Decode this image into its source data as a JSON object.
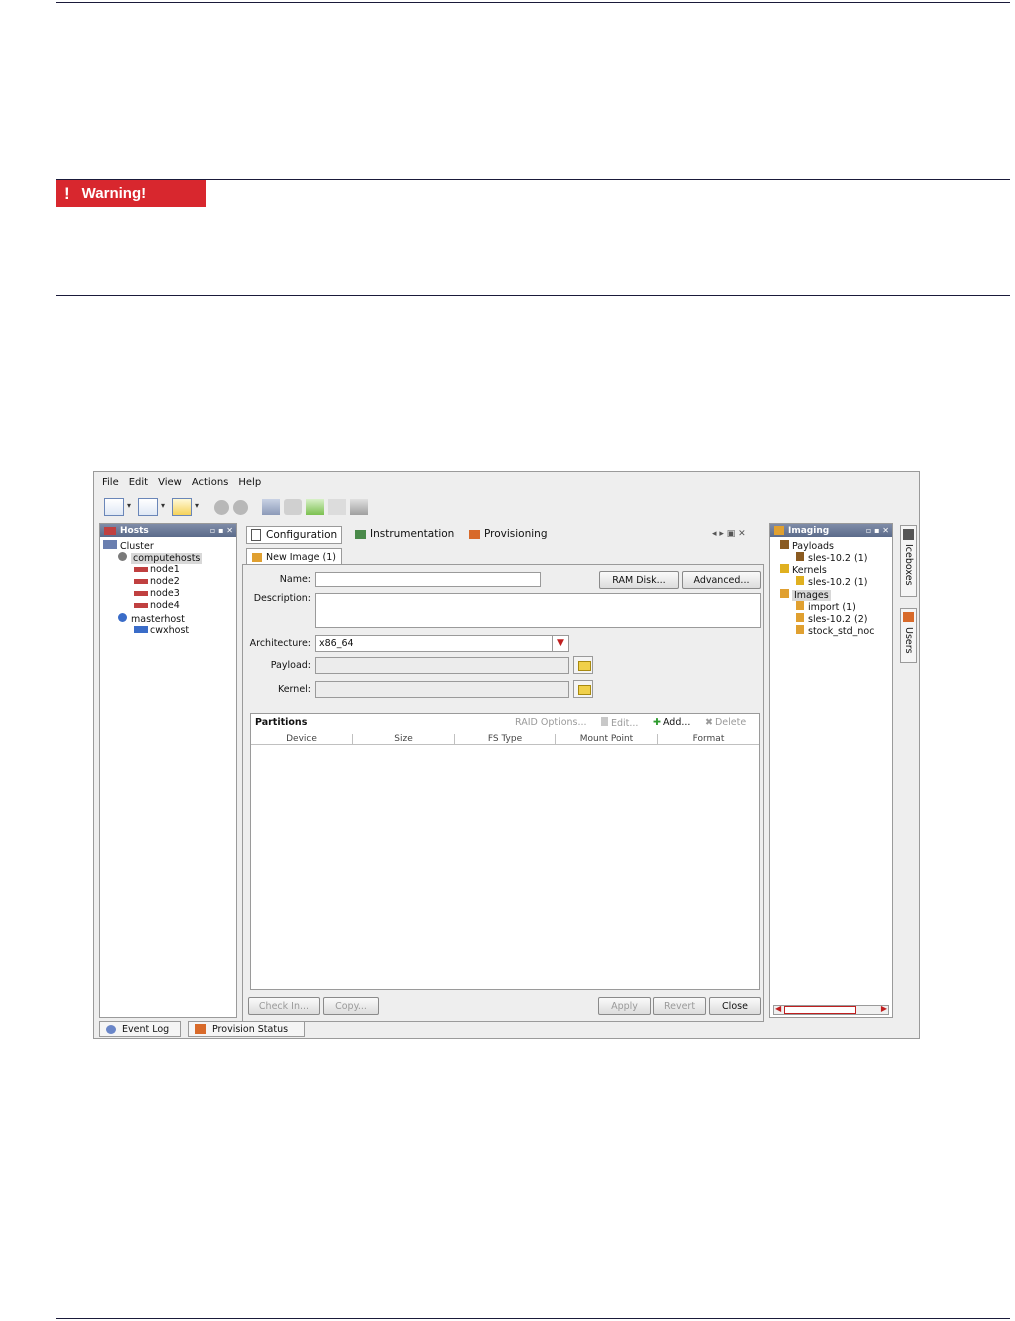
{
  "warning": {
    "label": "Warning!"
  },
  "app": {
    "menu": [
      "File",
      "Edit",
      "View",
      "Actions",
      "Help"
    ],
    "hosts_panel": {
      "title": "Hosts",
      "tree": {
        "root": "Cluster",
        "group1": "computehosts",
        "nodes": [
          "node1",
          "node2",
          "node3",
          "node4"
        ],
        "group2": "masterhost",
        "master_child": "cwxhost"
      }
    },
    "tabs": [
      "Configuration",
      "Instrumentation",
      "Provisioning"
    ],
    "subtab": "New Image (1)",
    "form": {
      "name_label": "Name:",
      "name_value": "",
      "description_label": "Description:",
      "architecture_label": "Architecture:",
      "architecture_value": "x86_64",
      "payload_label": "Payload:",
      "kernel_label": "Kernel:",
      "ram_disk_button": "RAM Disk...",
      "advanced_button": "Advanced..."
    },
    "partitions": {
      "title": "Partitions",
      "raid_options": "RAID Options...",
      "edit": "Edit...",
      "add": "Add...",
      "delete": "Delete",
      "columns": [
        "Device",
        "Size",
        "FS Type",
        "Mount Point",
        "Format"
      ]
    },
    "form_buttons": {
      "check_in": "Check In...",
      "copy": "Copy...",
      "apply": "Apply",
      "revert": "Revert",
      "close": "Close"
    },
    "imaging_panel": {
      "title": "Imaging",
      "payloads": "Payloads",
      "payload_item": "sles-10.2 (1)",
      "kernels": "Kernels",
      "kernel_item": "sles-10.2 (1)",
      "images": "Images",
      "image_items": [
        "import (1)",
        "sles-10.2 (2)",
        "stock_std_noc"
      ]
    },
    "side_tabs": [
      "Iceboxes",
      "Users"
    ],
    "bottom_tabs": [
      "Event Log",
      "Provision Status"
    ]
  }
}
